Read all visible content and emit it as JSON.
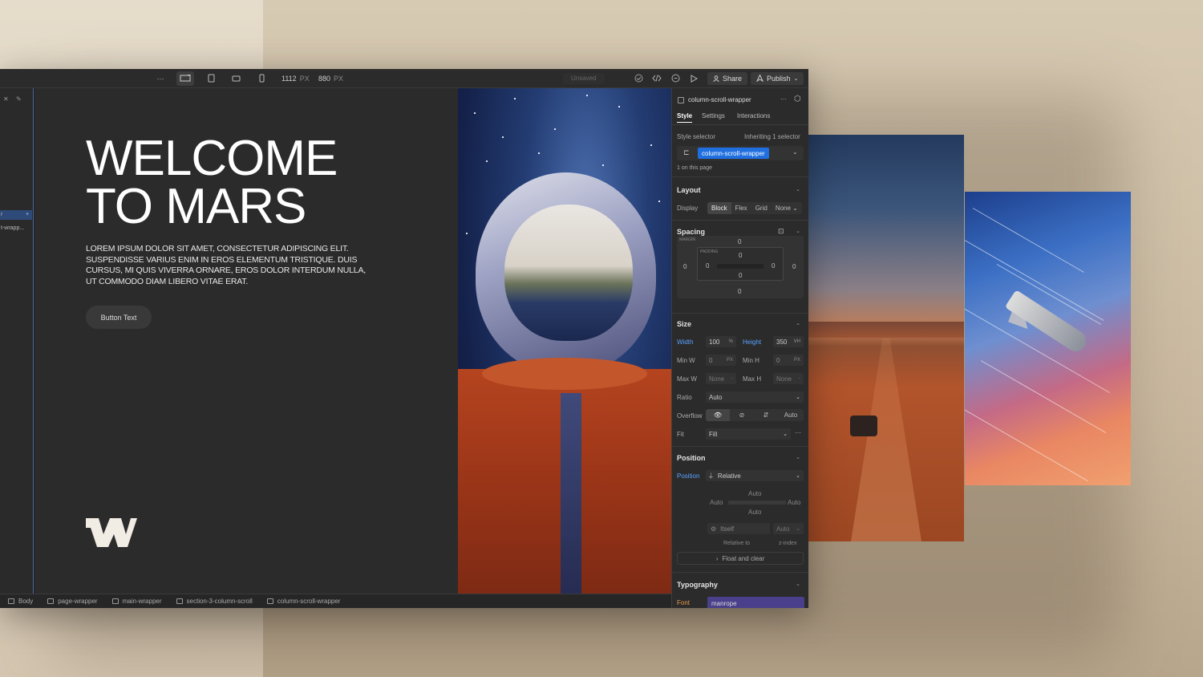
{
  "topbar": {
    "more": "···",
    "width_value": "1112",
    "width_unit": "PX",
    "height_value": "880",
    "height_unit": "PX",
    "unsaved": "Unsaved",
    "share": "Share",
    "publish": "Publish"
  },
  "leftrail": {
    "item1": "r",
    "item2": "t-wrapp..."
  },
  "hero": {
    "title_line1": "WELCOME",
    "title_line2": "TO MARS",
    "body": "LOREM IPSUM DOLOR SIT AMET, CONSECTETUR ADIPISCING ELIT. SUSPENDISSE VARIUS ENIM IN EROS ELEMENTUM TRISTIQUE. DUIS CURSUS, MI QUIS VIVERRA ORNARE, EROS DOLOR INTERDUM NULLA, UT COMMODO DIAM LIBERO VITAE ERAT.",
    "button": "Button Text"
  },
  "breadcrumbs": [
    "Body",
    "page-wrapper",
    "main-wrapper",
    "section-3-column-scroll",
    "column-scroll-wrapper"
  ],
  "panel": {
    "element_name": "column-scroll-wrapper",
    "more": "···",
    "tabs": [
      "Style",
      "Settings",
      "Interactions"
    ],
    "style_selector_label": "Style selector",
    "inheriting": "Inheriting 1 selector",
    "selector_chip": "column-scroll-wrapper",
    "on_page": "1 on this page",
    "layout": {
      "title": "Layout",
      "display_label": "Display",
      "options": [
        "Block",
        "Flex",
        "Grid",
        "None"
      ]
    },
    "spacing": {
      "title": "Spacing",
      "margin_label": "MARGIN",
      "padding_label": "PADDING",
      "margin_top": "0",
      "margin_left": "0",
      "margin_right": "0",
      "margin_bottom": "0",
      "padding_top": "0",
      "padding_left": "0",
      "padding_right": "0",
      "padding_bottom": "0"
    },
    "size": {
      "title": "Size",
      "width_label": "Width",
      "width_value": "100",
      "width_unit": "%",
      "height_label": "Height",
      "height_value": "350",
      "height_unit": "VH",
      "minw_label": "Min W",
      "minw_value": "0",
      "minw_unit": "PX",
      "minh_label": "Min H",
      "minh_value": "0",
      "minh_unit": "PX",
      "maxw_label": "Max W",
      "maxw_value": "None",
      "maxw_unit": "-",
      "maxh_label": "Max H",
      "maxh_value": "None",
      "maxh_unit": "-",
      "ratio_label": "Ratio",
      "ratio_value": "Auto",
      "overflow_label": "Overflow",
      "overflow_auto": "Auto",
      "fit_label": "Fit",
      "fit_value": "Fill",
      "fit_more": "···"
    },
    "position": {
      "title": "Position",
      "position_label": "Position",
      "position_value": "Relative",
      "top": "Auto",
      "left": "Auto",
      "right": "Auto",
      "bottom": "Auto",
      "itself": "Itself",
      "z_value": "Auto",
      "relative_to": "Relative to",
      "z_index": "z-index",
      "float_clear": "Float and clear"
    },
    "typography": {
      "title": "Typography",
      "font_label": "Font",
      "font_value": "manrope"
    }
  },
  "colors": {
    "accent": "#1f6fe0",
    "font_chip": "#4a3f8a"
  }
}
